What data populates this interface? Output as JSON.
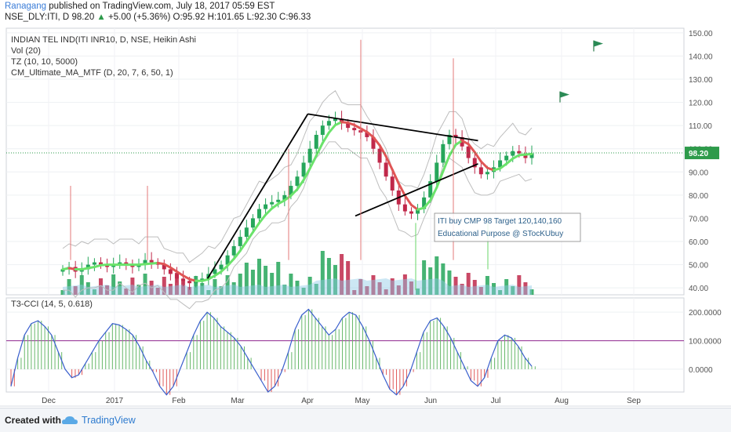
{
  "header": {
    "publisher": "Ranagang",
    "published_text": "published on TradingView.com, July 18, 2017 05:59 EST",
    "symbol": "NSE_DLY:ITI, D",
    "last": "98.20",
    "change": "+5.00 (+5.36%)",
    "ohlc": "O:95.92 H:101.65 L:92.30 C:96.33"
  },
  "legend": {
    "title": "INDIAN TEL IND(ITI INR10, D, NSE, Heikin Ashi",
    "ind1": "Vol (20)",
    "ind2": "TZ (10, 10, 5000)",
    "ind3": "CM_Ultimate_MA_MTF (D, 20, 7, 6, 50, 1)",
    "cci": "T3-CCI (14, 5, 0.618)"
  },
  "annotation": {
    "line1": "ITI buy CMP 98 Target 120,140,160",
    "line2": "Educational Purpose @ STocKUbuy"
  },
  "footer": {
    "created": "Created with",
    "brand": "TradingView"
  },
  "colors": {
    "up": "#26a65b",
    "down": "#c0284a",
    "ma_up": "#6be36b",
    "ma_down": "#e05555",
    "cci_line": "#3a5fcd",
    "cci_level": "#9c3f9c",
    "last_price": "#2e9b4b"
  },
  "chart_data": [
    {
      "type": "candlestick",
      "title": "INDIAN TEL IND(ITI INR10, D, NSE, Heikin Ashi",
      "ylim": [
        37,
        152
      ],
      "y_ticks": [
        "150.00",
        "140.00",
        "130.00",
        "120.00",
        "110.00",
        "100.00",
        "90.00",
        "80.00",
        "70.00",
        "60.00",
        "50.00",
        "40.00"
      ],
      "y_tick_values": [
        150,
        140,
        130,
        120,
        110,
        100,
        90,
        80,
        70,
        60,
        50,
        40
      ],
      "x_ticks": [
        "Dec",
        "2017",
        "Feb",
        "Mar",
        "Apr",
        "May",
        "Jun",
        "Jul",
        "Aug",
        "Sep"
      ],
      "last_price": 98.2,
      "close_series": [
        48,
        49,
        47,
        48,
        50,
        51,
        50,
        49,
        50,
        51,
        50,
        49,
        50,
        52,
        51,
        50,
        48,
        46,
        44,
        43,
        42,
        43,
        44,
        46,
        48,
        50,
        54,
        58,
        62,
        66,
        70,
        74,
        76,
        77,
        78,
        80,
        84,
        88,
        94,
        100,
        106,
        110,
        112,
        113,
        111,
        109,
        108,
        107,
        105,
        100,
        94,
        88,
        82,
        76,
        73,
        72,
        74,
        79,
        86,
        94,
        102,
        106,
        105,
        101,
        96,
        92,
        89,
        90,
        92,
        95,
        97,
        99,
        98,
        96,
        98
      ],
      "trendlines": [
        {
          "from": [
            0.297,
            44
          ],
          "to": [
            0.445,
            115
          ]
        },
        {
          "from": [
            0.445,
            115
          ],
          "to": [
            0.68,
            103.5
          ]
        },
        {
          "from": [
            0.515,
            71
          ],
          "to": [
            0.68,
            93.5
          ]
        }
      ],
      "flags": [
        {
          "x": "Jul",
          "y": 120
        },
        {
          "x": "Aug",
          "y": 142
        }
      ]
    },
    {
      "type": "line",
      "title": "T3-CCI (14, 5, 0.618)",
      "ylim": [
        -80,
        250
      ],
      "y_ticks": [
        "200.0000",
        "100.0000",
        "0.0000"
      ],
      "y_tick_values": [
        200,
        100,
        0
      ],
      "level": 100,
      "values": [
        -60,
        40,
        120,
        160,
        170,
        150,
        120,
        60,
        0,
        -30,
        -20,
        20,
        60,
        100,
        130,
        160,
        155,
        140,
        120,
        80,
        30,
        -10,
        -60,
        -90,
        -60,
        0,
        60,
        120,
        170,
        200,
        180,
        150,
        130,
        110,
        80,
        40,
        0,
        -40,
        -80,
        -60,
        -10,
        60,
        140,
        190,
        210,
        180,
        150,
        120,
        140,
        180,
        200,
        190,
        150,
        100,
        40,
        -20,
        -70,
        -90,
        -60,
        -10,
        60,
        130,
        170,
        180,
        150,
        110,
        60,
        10,
        -40,
        -60,
        -30,
        40,
        100,
        120,
        110,
        80,
        40,
        10
      ]
    }
  ]
}
